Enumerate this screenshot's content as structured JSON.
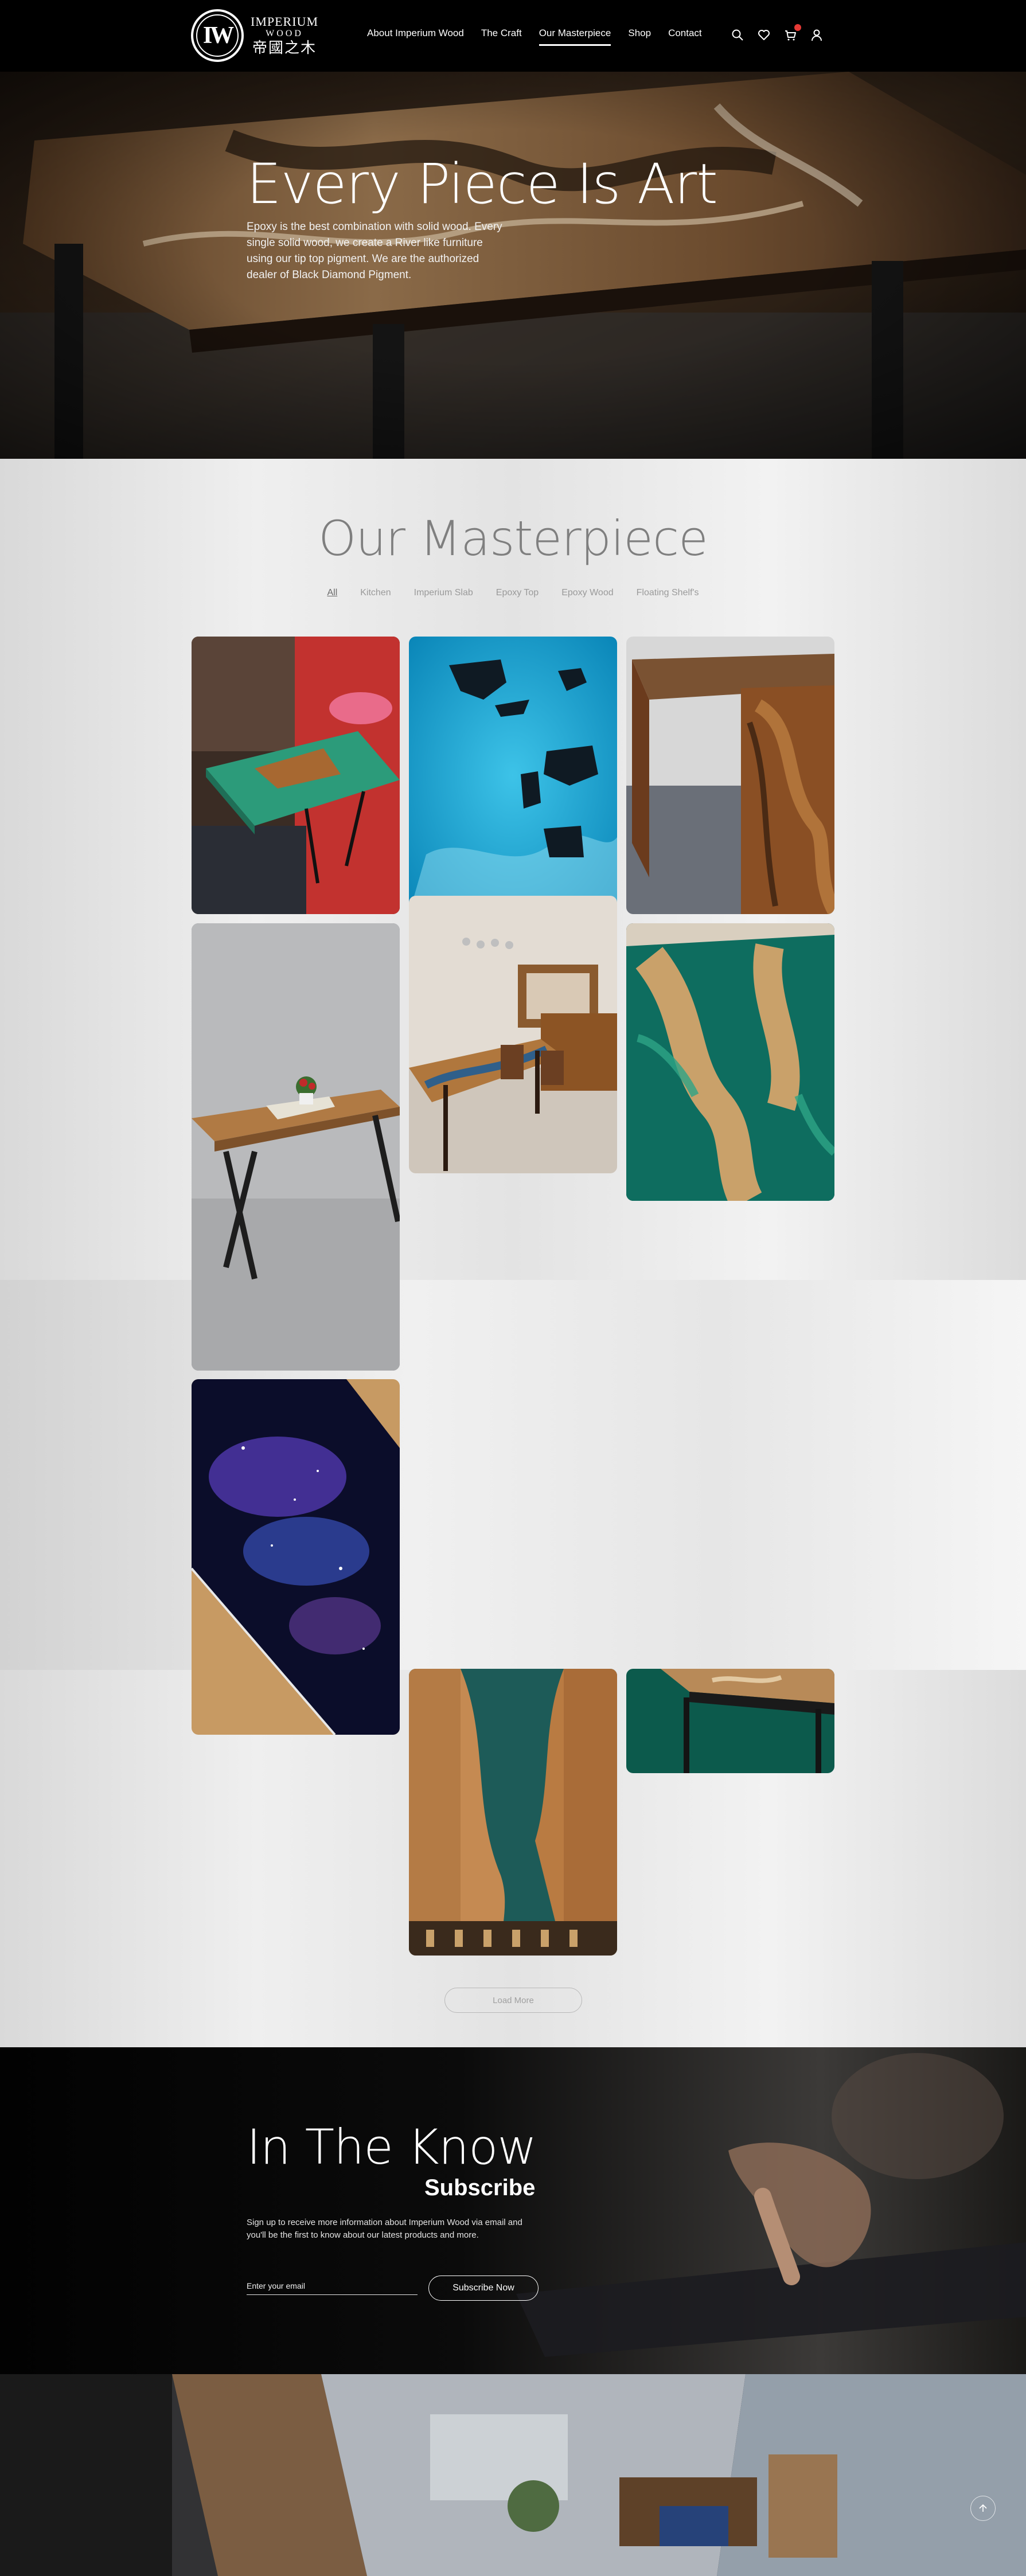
{
  "logo": {
    "line1": "IMPERIUM",
    "line2": "WOOD",
    "line3": "帝國之木",
    "mono": "IW"
  },
  "nav": [
    {
      "label": "About Imperium Wood",
      "active": false
    },
    {
      "label": "The Craft",
      "active": false
    },
    {
      "label": "Our Masterpiece",
      "active": true
    },
    {
      "label": "Shop",
      "active": false
    },
    {
      "label": "Contact",
      "active": false
    }
  ],
  "header_icons": [
    "search-icon",
    "heart-icon",
    "cart-icon",
    "user-icon"
  ],
  "hero": {
    "title": "Every Piece Is Art",
    "text": "Epoxy is the best combination with solid wood. Every single solid wood, we create a River like furniture using our tip top pigment. We are the authorized dealer of Black Diamond Pigment."
  },
  "masterpiece": {
    "title": "Our Masterpiece",
    "filters": [
      {
        "label": "All",
        "active": true
      },
      {
        "label": "Kitchen",
        "active": false
      },
      {
        "label": "Imperium Slab",
        "active": false
      },
      {
        "label": "Epoxy Top",
        "active": false
      },
      {
        "label": "Epoxy Wood",
        "active": false
      },
      {
        "label": "Floating Shelf's",
        "active": false
      }
    ],
    "load_more": "Load More"
  },
  "newsletter": {
    "title": "In The Know",
    "subtitle": "Subscribe",
    "text": "Sign up to receive more information about Imperium Wood via email and you'll be the first to know about our latest products and more.",
    "email_placeholder": "Enter your email",
    "button": "Subscribe Now"
  },
  "colors": {
    "header_bg": "#000000",
    "accent_badge": "#e53935",
    "muted_text": "#9a9a9a"
  }
}
